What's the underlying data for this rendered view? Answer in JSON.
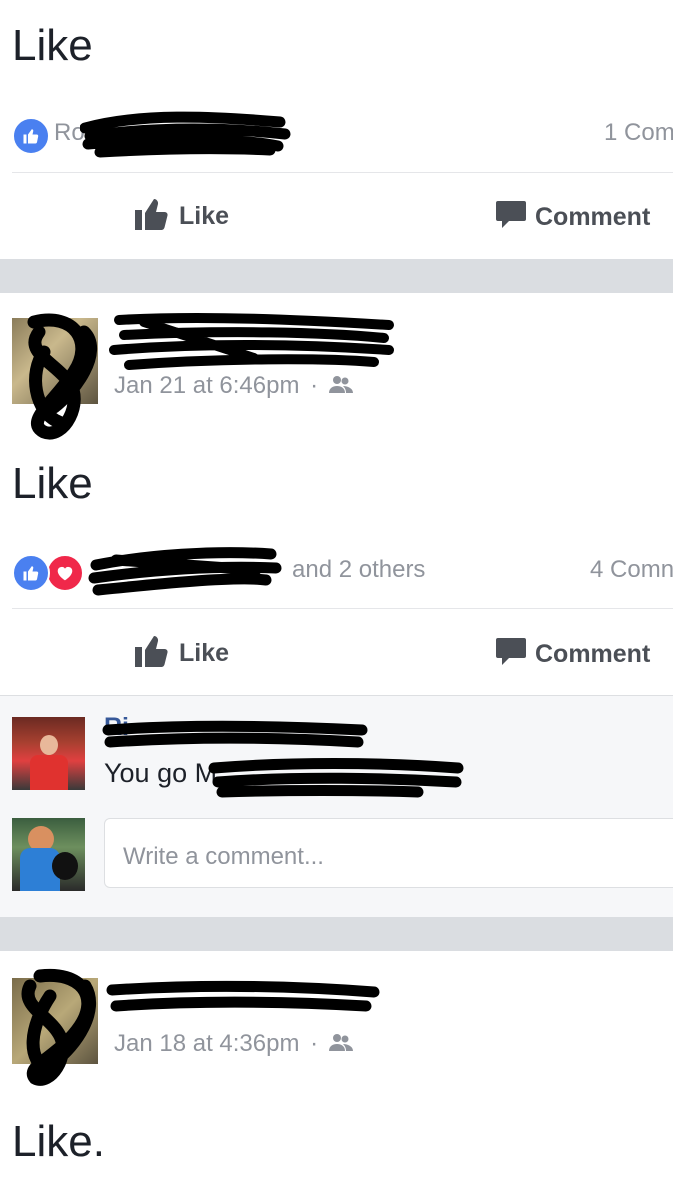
{
  "posts": [
    {
      "text": "Like",
      "reactions_summary": "Ro",
      "comments_count": "1 Com",
      "actions": {
        "like": "Like",
        "comment": "Comment"
      }
    },
    {
      "timestamp": "Jan 21 at 6:46pm",
      "audience_separator": "·",
      "text": "Like",
      "reactions_summary": "and 2 others",
      "comments_count": "4 Comn",
      "actions": {
        "like": "Like",
        "comment": "Comment"
      },
      "comment": {
        "author_partial": "Ri",
        "text": "You go M"
      },
      "comment_input": {
        "placeholder": "Write a comment..."
      }
    },
    {
      "timestamp": "Jan 18 at 4:36pm",
      "audience_separator": "·",
      "text": "Like."
    }
  ],
  "icons": {
    "like": "thumbs-up-icon",
    "comment": "comment-bubble-icon",
    "audience": "friends-icon",
    "reaction_like": "like-reaction-icon",
    "reaction_love": "love-reaction-icon"
  },
  "colors": {
    "facebook_blue": "#4a80f0",
    "love_red": "#f0284a",
    "meta_gray": "#90949c",
    "action_gray": "#4b4f56",
    "feed_gap": "#dadde1"
  }
}
